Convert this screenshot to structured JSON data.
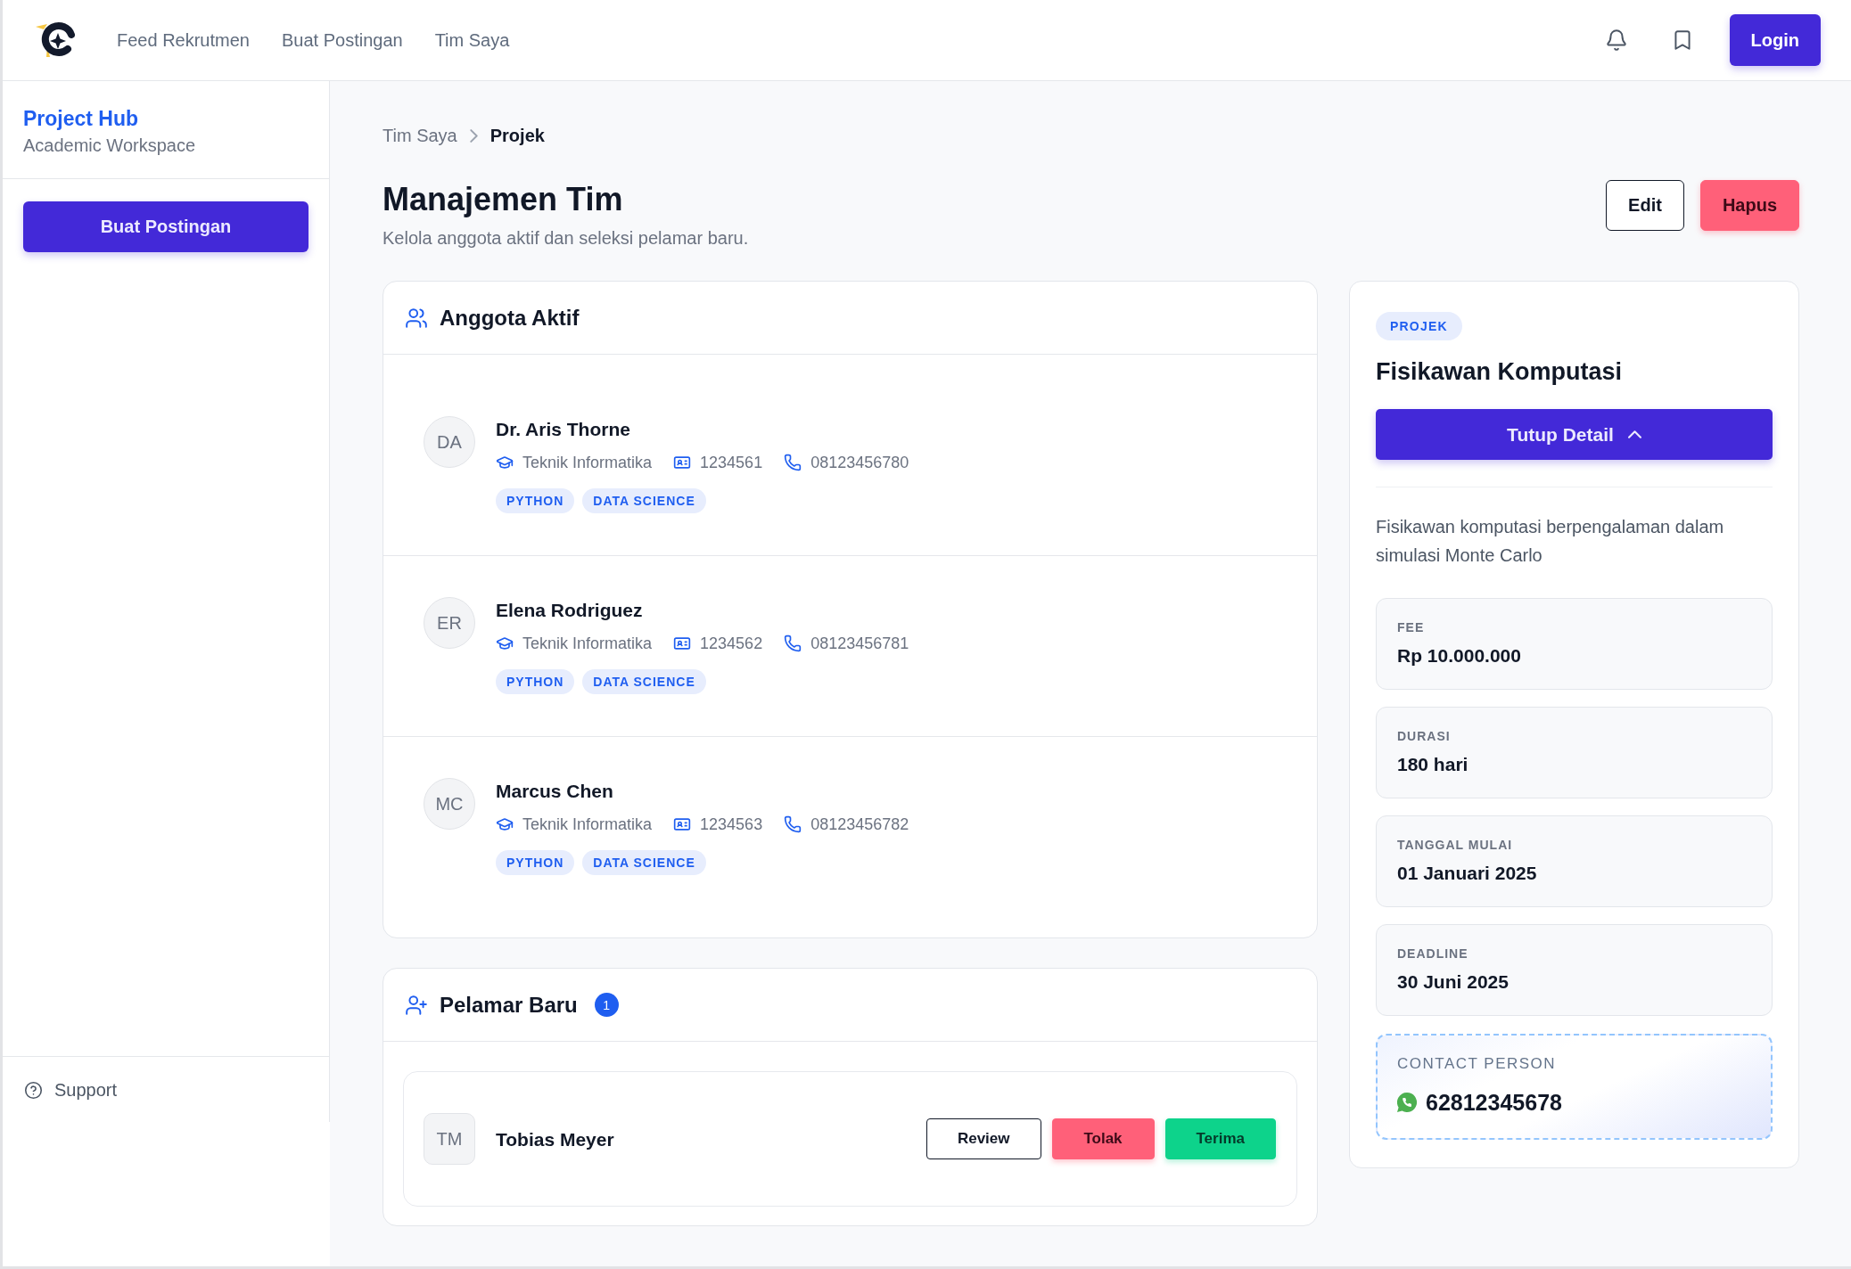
{
  "navbar": {
    "links": [
      "Feed Rekrutmen",
      "Buat Postingan",
      "Tim Saya"
    ],
    "login_button": "Login"
  },
  "sidebar": {
    "title": "Project Hub",
    "subtitle": "Academic Workspace",
    "create_button": "Buat Postingan",
    "support_link": "Support"
  },
  "breadcrumb": [
    "Tim Saya",
    "Projek"
  ],
  "page": {
    "title": "Manajemen Tim",
    "subtitle": "Kelola anggota aktif dan seleksi pelamar baru.",
    "actions": [
      {
        "label": "Edit",
        "kind": "outline"
      },
      {
        "label": "Hapus",
        "kind": "danger"
      }
    ]
  },
  "active_members": {
    "title": "Anggota Aktif",
    "members": [
      {
        "initials": "DA",
        "name": "Dr. Aris Thorne",
        "department": "Teknik Informatika",
        "student_id": "1234561",
        "phone": "08123456780",
        "tags": [
          "PYTHON",
          "DATA SCIENCE"
        ]
      },
      {
        "initials": "ER",
        "name": "Elena Rodriguez",
        "department": "Teknik Informatika",
        "student_id": "1234562",
        "phone": "08123456781",
        "tags": [
          "PYTHON",
          "DATA SCIENCE"
        ]
      },
      {
        "initials": "MC",
        "name": "Marcus Chen",
        "department": "Teknik Informatika",
        "student_id": "1234563",
        "phone": "08123456782",
        "tags": [
          "PYTHON",
          "DATA SCIENCE"
        ]
      }
    ]
  },
  "new_applicants": {
    "title": "Pelamar Baru",
    "count": "1",
    "applicants": [
      {
        "initials": "TM",
        "name": "Tobias Meyer",
        "actions": [
          {
            "label": "Review",
            "kind": "outline"
          },
          {
            "label": "Tolak",
            "kind": "danger"
          },
          {
            "label": "Terima",
            "kind": "success"
          }
        ]
      }
    ]
  },
  "project": {
    "badge": "PROJEK",
    "title": "Fisikawan Komputasi",
    "toggle_button": "Tutup Detail",
    "expanded": true,
    "description": "Fisikawan komputasi berpengalaman dalam simulasi Monte Carlo",
    "details": [
      {
        "label": "FEE",
        "value": "Rp 10.000.000"
      },
      {
        "label": "DURASI",
        "value": "180 hari"
      },
      {
        "label": "TANGGAL MULAI",
        "value": "01 Januari 2025"
      },
      {
        "label": "DEADLINE",
        "value": "30 Juni 2025"
      }
    ],
    "contact": {
      "label": "CONTACT PERSON",
      "phone": "62812345678"
    }
  }
}
